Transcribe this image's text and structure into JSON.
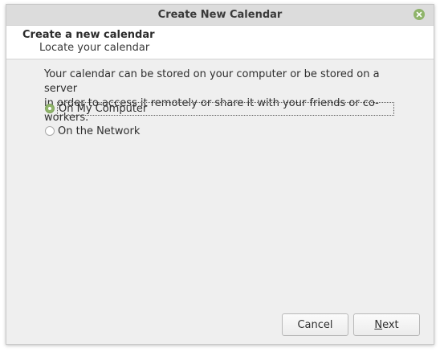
{
  "window": {
    "title": "Create New Calendar"
  },
  "header": {
    "title": "Create a new calendar",
    "subtitle": "Locate your calendar"
  },
  "body": {
    "description_line1": "Your calendar can be stored on your computer or be stored on a server",
    "description_line2": "in order to access it remotely or share it with your friends or co-workers."
  },
  "options": [
    {
      "label": "On My Computer",
      "selected": true
    },
    {
      "label": "On the Network",
      "selected": false
    }
  ],
  "buttons": {
    "cancel": "Cancel",
    "next_mnemonic": "N",
    "next_rest": "ext"
  },
  "colors": {
    "accent": "#8fb46a",
    "window_bg": "#efefef",
    "titlebar_bg": "#dcdcdc"
  }
}
